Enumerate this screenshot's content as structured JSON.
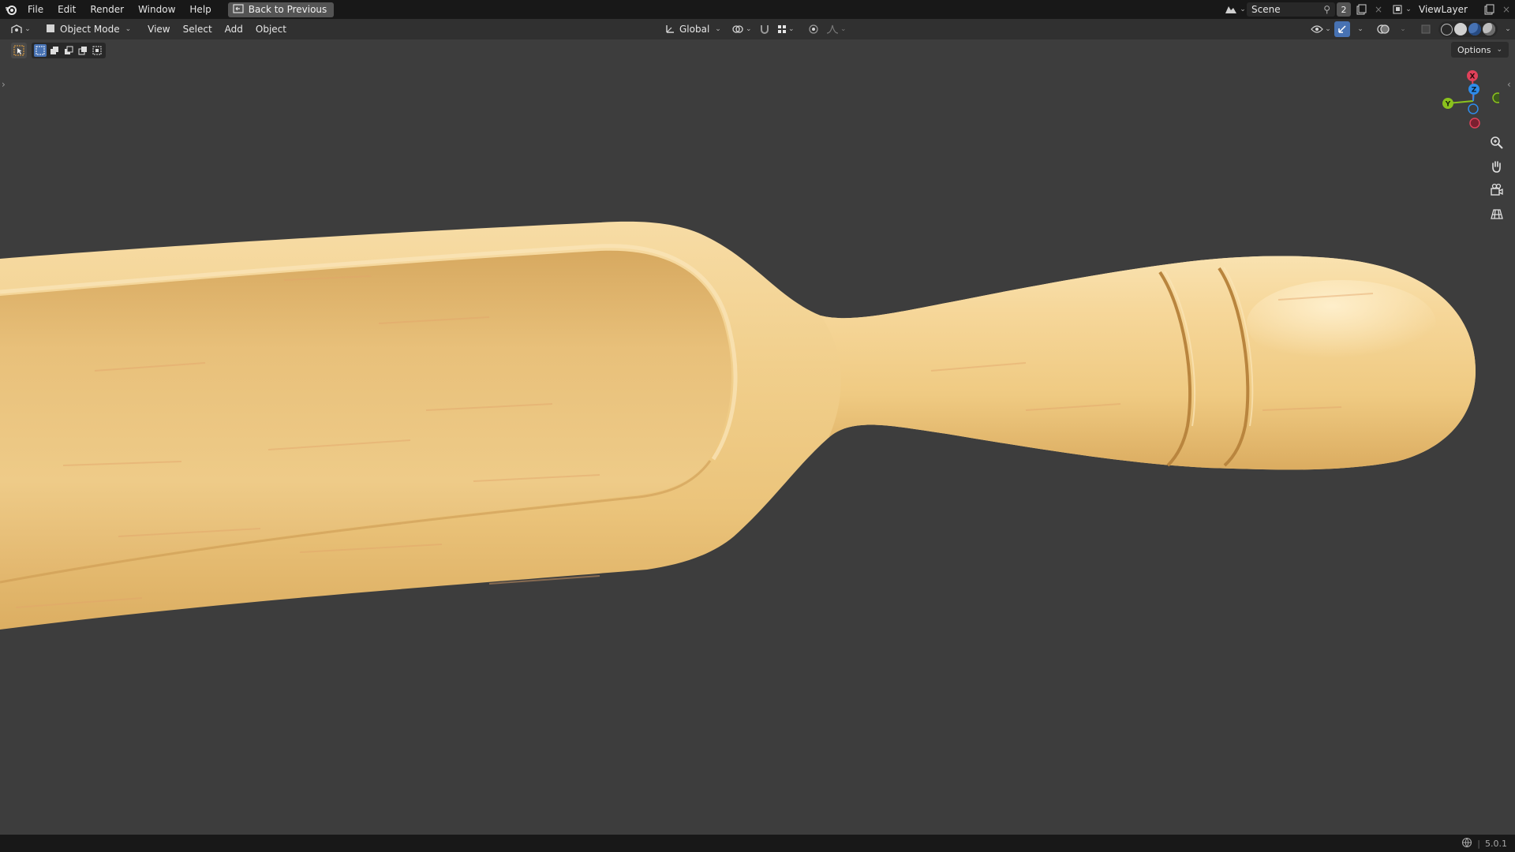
{
  "topbar": {
    "logo_icon": "blender-logo-icon",
    "menus": [
      "File",
      "Edit",
      "Render",
      "Window",
      "Help"
    ],
    "back_button": "Back to Previous",
    "scene_name": "Scene",
    "scene_users": "2",
    "view_layer": "ViewLayer"
  },
  "viewport_header": {
    "editor_type_icon": "3d-viewport-icon",
    "mode": "Object Mode",
    "menus": [
      "View",
      "Select",
      "Add",
      "Object"
    ],
    "transform_orientation": "Global",
    "options_label": "Options"
  },
  "toolbar": {
    "active_tool": "select-box-icon",
    "selection_modes": [
      "new-selection-icon",
      "extend-selection-icon",
      "subtract-selection-icon",
      "invert-selection-icon",
      "intersect-selection-icon"
    ]
  },
  "gizmo": {
    "x_label": "X",
    "y_label": "Y",
    "z_label": "Z",
    "colors": {
      "x": "#e0415a",
      "y": "#8bc21d",
      "z": "#2d8ceb"
    }
  },
  "nav_buttons": [
    "zoom-icon",
    "pan-hand-icon",
    "camera-view-icon",
    "orthographic-grid-icon"
  ],
  "statusbar": {
    "version": "5.0.1"
  },
  "colors": {
    "viewport_bg": "#3d3d3d",
    "wood_light": "#f3d193",
    "wood_mid": "#e8bd72",
    "wood_dark": "#c99a52"
  }
}
